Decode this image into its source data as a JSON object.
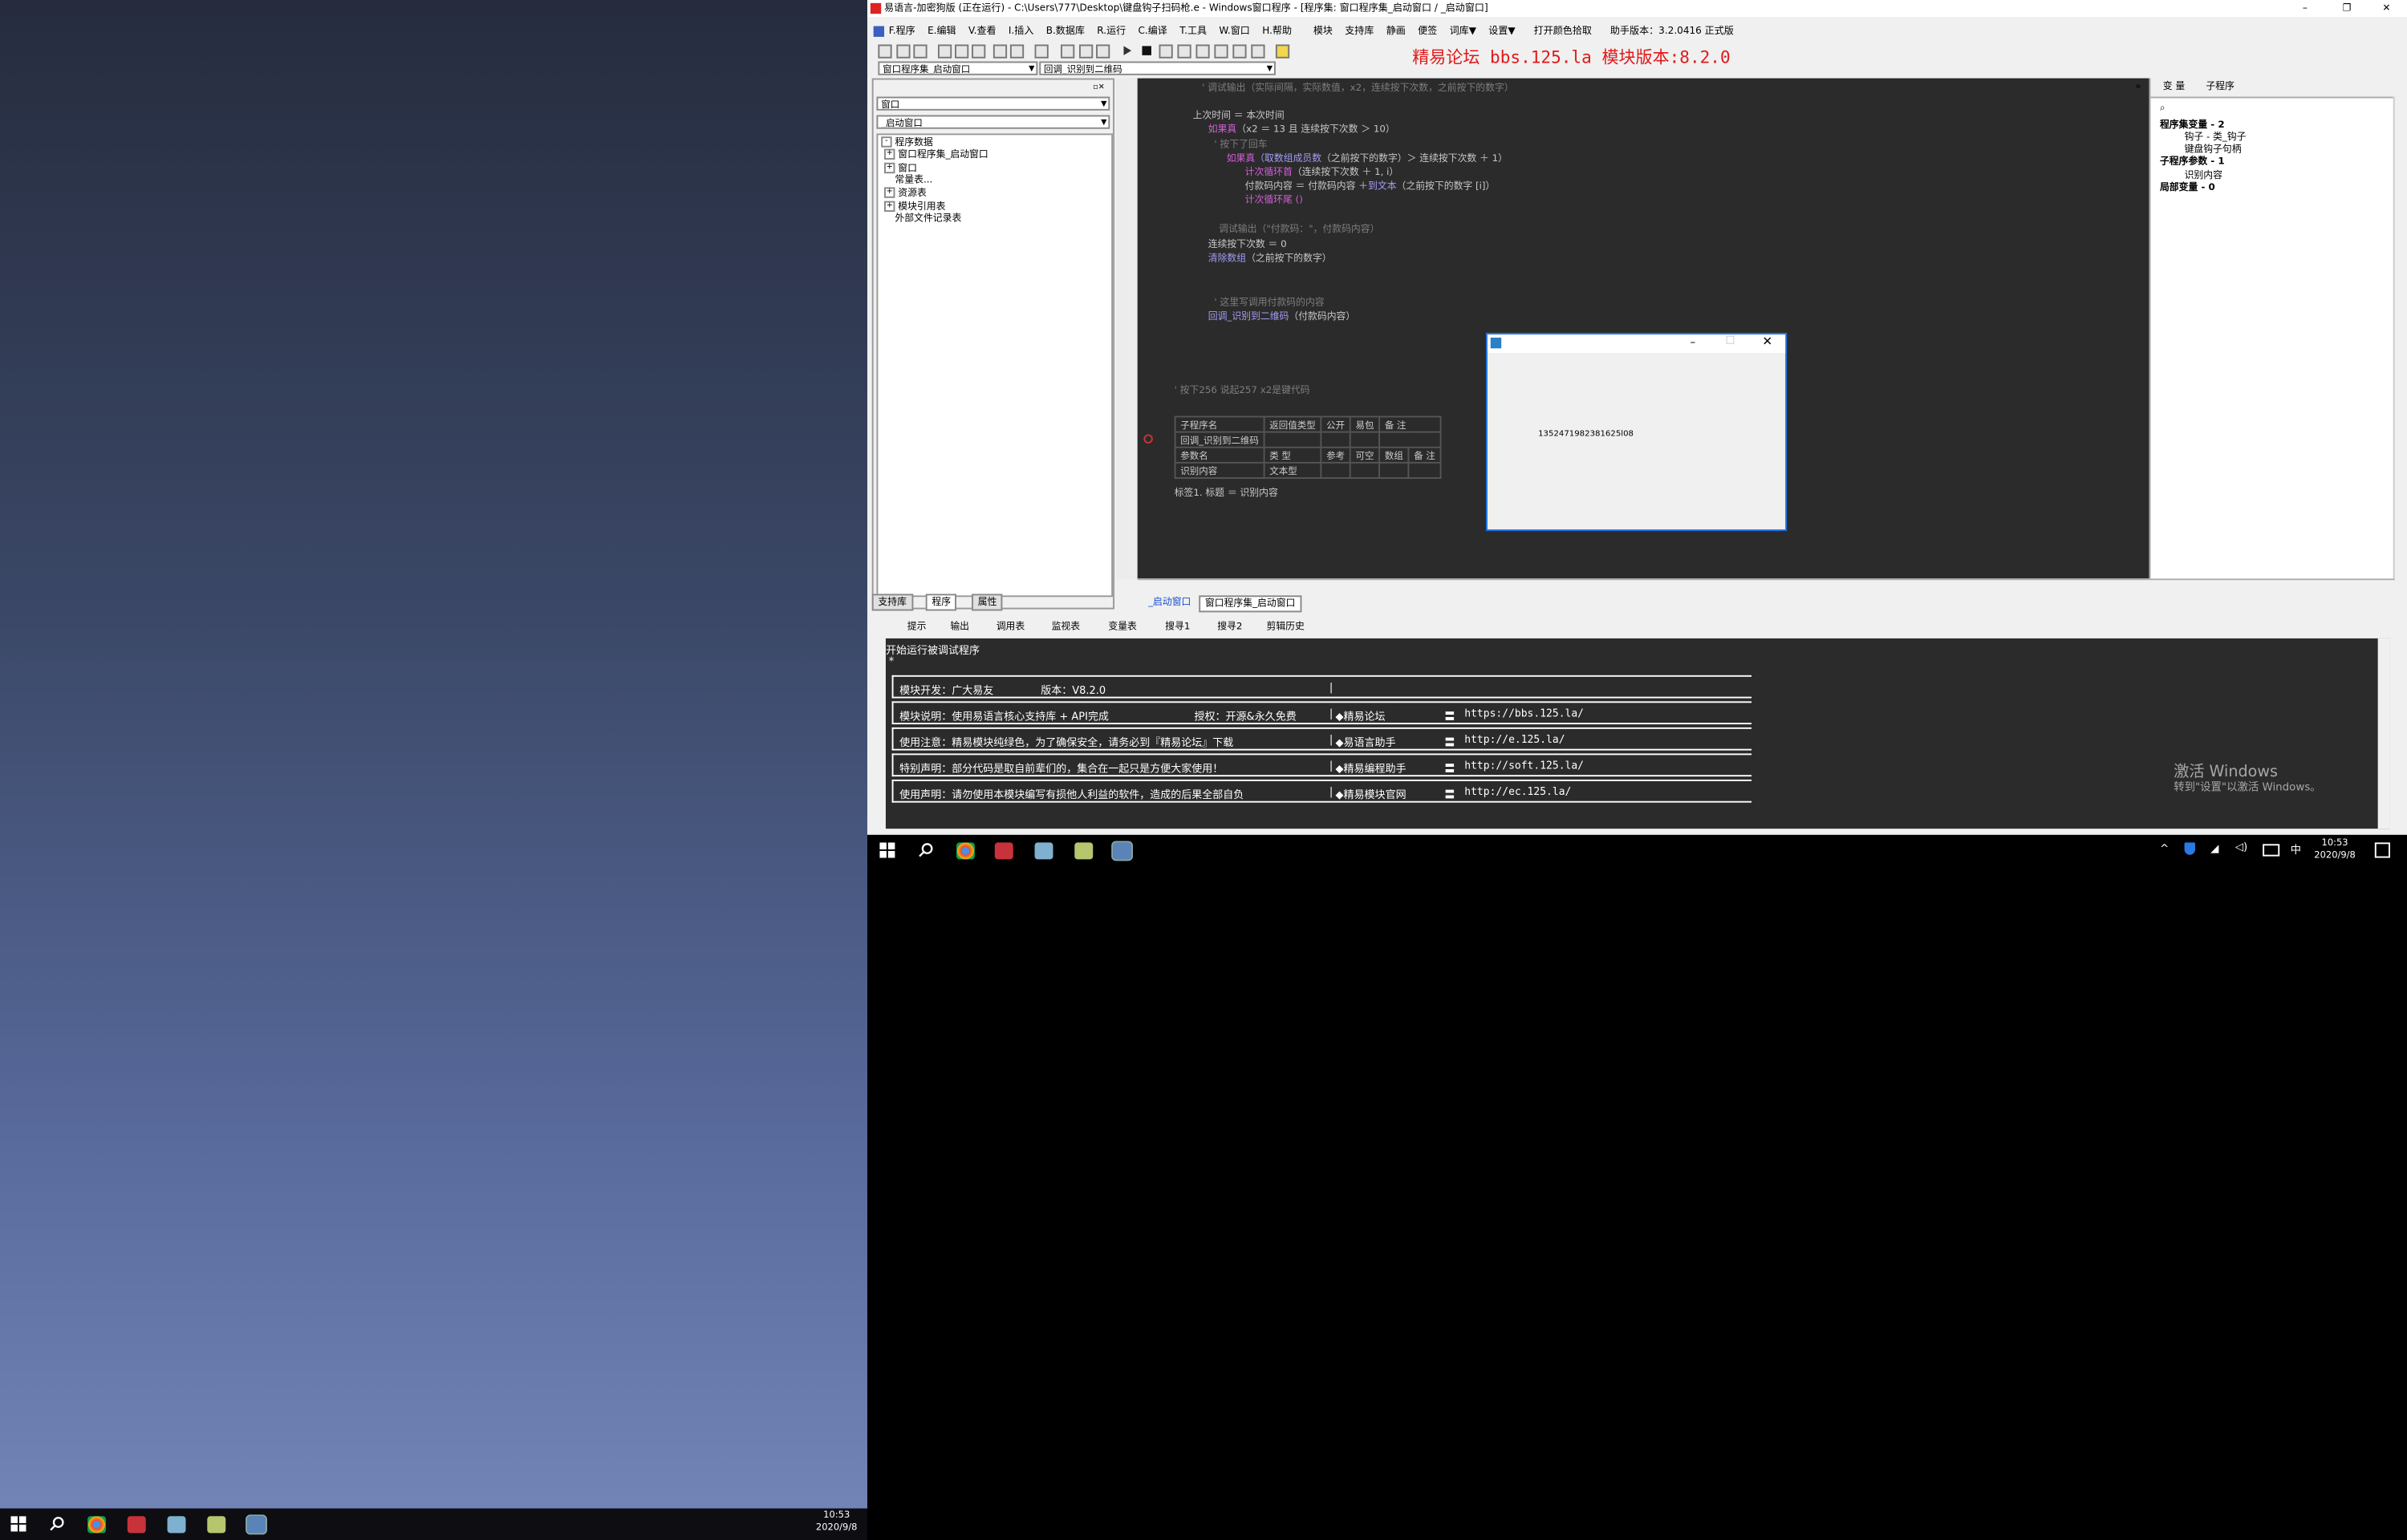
{
  "window": {
    "title": "易语言-加密狗版 (正在运行) - C:\\Users\\777\\Desktop\\键盘钩子扫码枪.e - Windows窗口程序 - [程序集: 窗口程序集_启动窗口 / _启动窗口]",
    "controls": {
      "minimize": "–",
      "restore": "❐",
      "close": "✕"
    }
  },
  "menu": [
    "F.程序",
    "E.编辑",
    "V.查看",
    "I.插入",
    "B.数据库",
    "R.运行",
    "C.编译",
    "T.工具",
    "W.窗口",
    "H.帮助",
    "模块",
    "支持库",
    "静画",
    "便签",
    "词库▼",
    "设置▼",
    "打开颜色拾取",
    "助手版本：3.2.0416 正式版"
  ],
  "banner": "精易论坛 bbs.125.la 模块版本:8.2.0",
  "selectors": {
    "left": "窗口程序集_启动窗口",
    "right": "回调_识别到二维码"
  },
  "left_panel": {
    "combo1": "窗口",
    "combo2": "_启动窗口",
    "tree": [
      "程序数据",
      "窗口程序集_启动窗口",
      "窗口",
      "常量表...",
      "资源表",
      "模块引用表",
      "外部文件记录表"
    ],
    "tabs": [
      "支持库",
      "程序",
      "属性"
    ]
  },
  "code": {
    "line1": "' 调试输出（实际间隔，实际数值，x2，连续按下次数，之前按下的数字）",
    "line2a": "上次时间 ＝ 本次时间",
    "line3a": "如果真",
    "line3b": "（x2 ＝ 13 且 连续按下次数 ＞ 10）",
    "line4": "' 按下了回车",
    "line5a": "如果真",
    "line5b": "（取数组成员数",
    "line5c": "（之前按下的数字）＞ 连续按下次数 ＋ 1）",
    "line6a": "计次循环首",
    "line6b": "（连续按下次数 ＋ 1, i）",
    "line7a": "付款码内容 ＝ 付款码内容 ＋",
    "line7b": "到文本",
    "line7c": "（之前按下的数字 [i]）",
    "line8": "计次循环尾 ()",
    "line9": "调试输出（\"付款码：\"，付款码内容）",
    "line10": "连续按下次数 ＝ 0",
    "line11a": "清除数组",
    "line11b": "（之前按下的数字）",
    "line12": "' 这里写调用付款码的内容",
    "line13a": "回调_识别到二维码",
    "line13b": "（付款码内容）",
    "comment2": "' 按下256 说起257    x2是键代码",
    "table": {
      "h1": [
        "子程序名",
        "返回值类型",
        "公开",
        "易包",
        "备 注"
      ],
      "r1": [
        "回调_识别到二维码"
      ],
      "h2": [
        "参数名",
        "类 型",
        "参考",
        "可空",
        "数组",
        "备 注"
      ],
      "r2": [
        "识别内容",
        "文本型"
      ]
    },
    "last": "标签1. 标题 ＝ 识别内容"
  },
  "code_tabs": [
    "_启动窗口",
    "窗口程序集_启动窗口"
  ],
  "right_panel": {
    "tabs": [
      "变 量",
      "子程序"
    ],
    "tree": [
      "程序集变量 - 2",
      "钩子 - 类_钩子",
      "键盘钩子句柄",
      "子程序参数 - 1",
      "识别内容",
      "局部变量 - 0"
    ]
  },
  "bottom_tools": [
    "提示",
    "输出",
    "调用表",
    "监视表",
    "变量表",
    "搜寻1",
    "搜寻2",
    "剪辑历史"
  ],
  "output": {
    "line1": "开始运行被调试程序",
    "line2": "*",
    "rows": [
      {
        "c1": "模块开发：广大易友",
        "c1v": "版本：V8.2.0",
        "c2": "",
        "c3": "",
        "c3v": ""
      },
      {
        "c1": "模块说明：使用易语言核心支持库 + API完成",
        "c1v": "授权：开源&永久免费",
        "c2": "◆精易论坛",
        "c3": "〓",
        "c3v": "https://bbs.125.la/"
      },
      {
        "c1": "使用注意：精易模块纯绿色，为了确保安全，请务必到『精易论坛』下载",
        "c1v": "",
        "c2": "◆易语言助手",
        "c3": "〓",
        "c3v": "http://e.125.la/"
      },
      {
        "c1": "特别声明：部分代码是取自前辈们的，集合在一起只是方便大家使用！",
        "c1v": "",
        "c2": "◆精易编程助手",
        "c3": "〓",
        "c3v": "http://soft.125.la/"
      },
      {
        "c1": "使用声明：请勿使用本模块编写有损他人利益的软件，造成的后果全部自负",
        "c1v": "",
        "c2": "◆精易模块官网",
        "c3": "〓",
        "c3v": "http://ec.125.la/"
      }
    ]
  },
  "watermark": {
    "line1": "激活 Windows",
    "line2": "转到\"设置\"以激活 Windows。"
  },
  "dialog": {
    "value": "1352471982381625l08"
  },
  "taskbar_right": {
    "time": "10:53",
    "date": "2020/9/8",
    "ime": "中"
  },
  "taskbar_left": {
    "time": "10:53",
    "date": "2020/9/8"
  }
}
